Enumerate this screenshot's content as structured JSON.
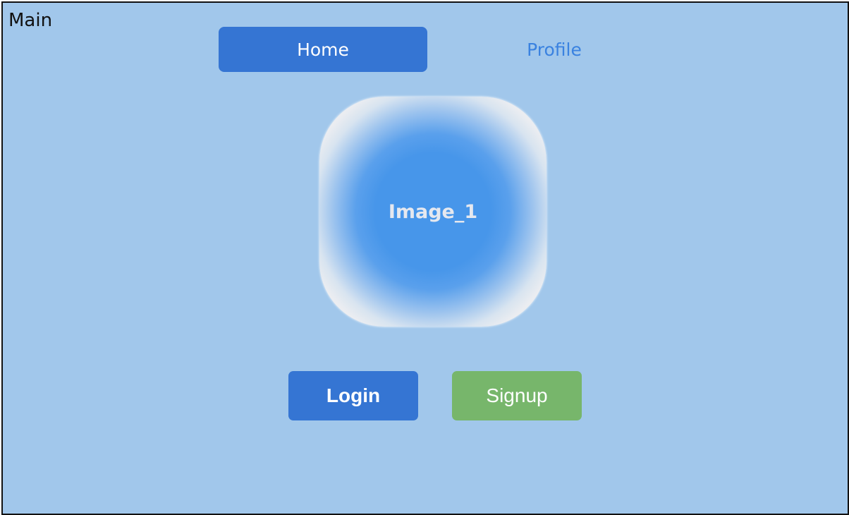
{
  "window": {
    "title": "Main"
  },
  "tabs": [
    {
      "label": "Home",
      "active": true
    },
    {
      "label": "Profile",
      "active": false
    }
  ],
  "image": {
    "label": "Image_1"
  },
  "actions": {
    "login_label": "Login",
    "signup_label": "Signup"
  },
  "colors": {
    "background": "#a1c7eb",
    "primary": "#3575d3",
    "link": "#3a82e0",
    "signup": "#77b66b",
    "image_center": "#4796ea"
  }
}
